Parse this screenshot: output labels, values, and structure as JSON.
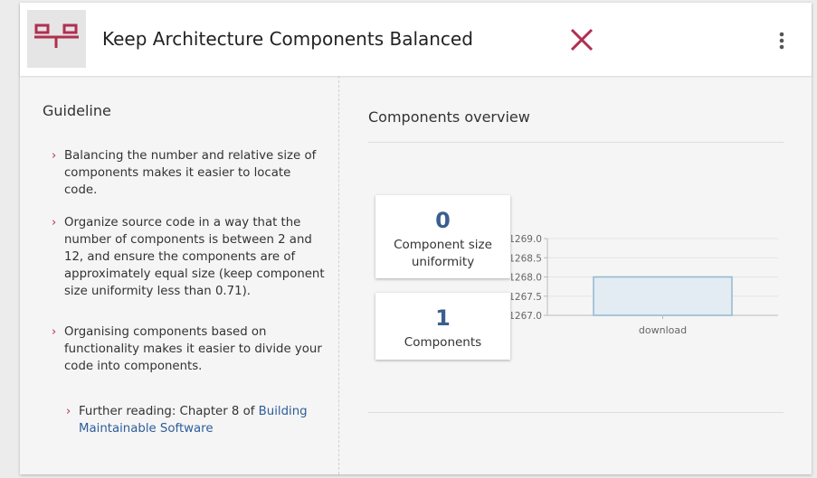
{
  "header": {
    "title": "Keep Architecture Components Balanced",
    "icons": {
      "logo": "architecture-components-icon",
      "close": "close-icon",
      "menu": "kebab-menu-icon"
    },
    "colors": {
      "accent": "#b03050",
      "number": "#3a5f8f",
      "link": "#2d5d9b"
    }
  },
  "guideline": {
    "title": "Guideline",
    "items": [
      "Balancing the number and relative size of components makes it easier to locate code.",
      "Organize source code in a way that the number of components is between 2 and 12, and ensure the components are of approximately equal size (keep component size uniformity less than 0.71).",
      "Organising components based on functionality makes it easier to divide your code into components."
    ],
    "further_reading_prefix": "Further reading: Chapter 8 of ",
    "further_reading_link": "Building Maintainable Software"
  },
  "overview": {
    "title": "Components overview",
    "metrics": [
      {
        "value": "0",
        "label": "Component size uniformity"
      },
      {
        "value": "1",
        "label": "Components"
      }
    ]
  },
  "chart_data": {
    "type": "bar",
    "categories": [
      "download"
    ],
    "values": [
      1268.0
    ],
    "ylim": [
      1267.0,
      1269.0
    ],
    "yticks": [
      "1269.0",
      "1268.5",
      "1268.0",
      "1267.5",
      "1267.0"
    ],
    "grid": true,
    "bar_fill": "#e2ecf2",
    "bar_stroke": "#93b8d0",
    "title": "",
    "xlabel": "",
    "ylabel": ""
  }
}
